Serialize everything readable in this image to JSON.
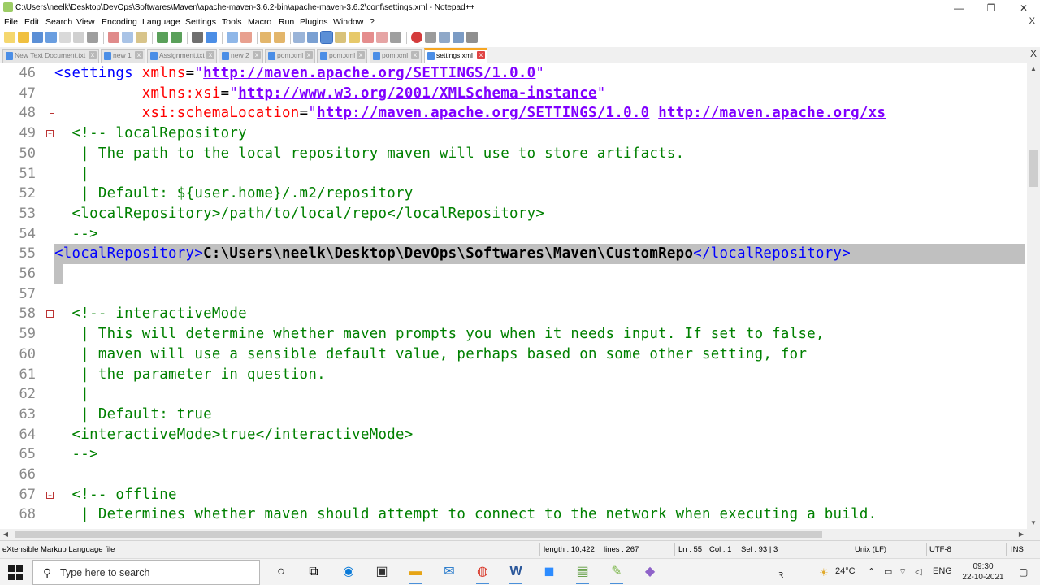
{
  "window": {
    "title": "C:\\Users\\neelk\\Desktop\\DevOps\\Softwares\\Maven\\apache-maven-3.6.2-bin\\apache-maven-3.6.2\\conf\\settings.xml - Notepad++",
    "minimize": "—",
    "maximize": "❐",
    "close": "✕"
  },
  "menu": {
    "items": [
      "File",
      "Edit",
      "Search",
      "View",
      "Encoding",
      "Language",
      "Settings",
      "Tools",
      "Macro",
      "Run",
      "Plugins",
      "Window",
      "?"
    ],
    "close": "X"
  },
  "tabs": [
    {
      "label": "New Text Document.txt",
      "active": false
    },
    {
      "label": "new 1",
      "active": false
    },
    {
      "label": "Assignment.txt",
      "active": false
    },
    {
      "label": "new 2",
      "active": false
    },
    {
      "label": "pom.xml",
      "active": false
    },
    {
      "label": "pom.xml",
      "active": false
    },
    {
      "label": "pom.xml",
      "active": false
    },
    {
      "label": "settings.xml",
      "active": true
    }
  ],
  "tabbar_close": "X",
  "editor": {
    "lines": [
      {
        "n": "46",
        "fold": false,
        "parts": [
          [
            "c-tag",
            "<settings "
          ],
          [
            "c-attr",
            "xmlns"
          ],
          [
            "c-pl",
            "="
          ],
          [
            "c-str",
            "\""
          ],
          [
            "c-val",
            "http://maven.apache.org/SETTINGS/1.0.0"
          ],
          [
            "c-str",
            "\""
          ]
        ]
      },
      {
        "n": "47",
        "fold": false,
        "parts": [
          [
            "c-pl",
            "          "
          ],
          [
            "c-attr",
            "xmlns:xsi"
          ],
          [
            "c-pl",
            "="
          ],
          [
            "c-str",
            "\""
          ],
          [
            "c-val",
            "http://www.w3.org/2001/XMLSchema-instance"
          ],
          [
            "c-str",
            "\""
          ]
        ]
      },
      {
        "n": "48",
        "fold": "end",
        "parts": [
          [
            "c-pl",
            "          "
          ],
          [
            "c-attr",
            "xsi:schemaLocation"
          ],
          [
            "c-pl",
            "="
          ],
          [
            "c-str",
            "\""
          ],
          [
            "c-val",
            "http://maven.apache.org/SETTINGS/1.0.0"
          ],
          [
            "c-pl",
            " "
          ],
          [
            "c-val",
            "http://maven.apache.org/xs"
          ]
        ]
      },
      {
        "n": "49",
        "fold": "start",
        "parts": [
          [
            "c-com",
            "  <!-- localRepository"
          ]
        ]
      },
      {
        "n": "50",
        "fold": false,
        "parts": [
          [
            "c-com",
            "   | The path to the local repository maven will use to store artifacts."
          ]
        ]
      },
      {
        "n": "51",
        "fold": false,
        "parts": [
          [
            "c-com",
            "   |"
          ]
        ]
      },
      {
        "n": "52",
        "fold": false,
        "parts": [
          [
            "c-com",
            "   | Default: ${user.home}/.m2/repository"
          ]
        ]
      },
      {
        "n": "53",
        "fold": false,
        "parts": [
          [
            "c-com",
            "  <localRepository>/path/to/local/repo</localRepository>"
          ]
        ]
      },
      {
        "n": "54",
        "fold": false,
        "parts": [
          [
            "c-com",
            "  -->"
          ]
        ]
      },
      {
        "n": "55",
        "fold": false,
        "selected": true,
        "parts": [
          [
            "c-tag",
            "<localRepository>"
          ],
          [
            "c-txt",
            "C:\\Users\\neelk\\Desktop\\DevOps\\Softwares\\Maven\\CustomRepo"
          ],
          [
            "c-tag",
            "</localRepository>"
          ]
        ]
      },
      {
        "n": "56",
        "fold": false,
        "selected": "caret",
        "parts": []
      },
      {
        "n": "57",
        "fold": false,
        "parts": []
      },
      {
        "n": "58",
        "fold": "start",
        "parts": [
          [
            "c-com",
            "  <!-- interactiveMode"
          ]
        ]
      },
      {
        "n": "59",
        "fold": false,
        "parts": [
          [
            "c-com",
            "   | This will determine whether maven prompts you when it needs input. If set to false,"
          ]
        ]
      },
      {
        "n": "60",
        "fold": false,
        "parts": [
          [
            "c-com",
            "   | maven will use a sensible default value, perhaps based on some other setting, for"
          ]
        ]
      },
      {
        "n": "61",
        "fold": false,
        "parts": [
          [
            "c-com",
            "   | the parameter in question."
          ]
        ]
      },
      {
        "n": "62",
        "fold": false,
        "parts": [
          [
            "c-com",
            "   |"
          ]
        ]
      },
      {
        "n": "63",
        "fold": false,
        "parts": [
          [
            "c-com",
            "   | Default: true"
          ]
        ]
      },
      {
        "n": "64",
        "fold": false,
        "parts": [
          [
            "c-com",
            "  <interactiveMode>true</interactiveMode>"
          ]
        ]
      },
      {
        "n": "65",
        "fold": false,
        "parts": [
          [
            "c-com",
            "  -->"
          ]
        ]
      },
      {
        "n": "66",
        "fold": false,
        "parts": []
      },
      {
        "n": "67",
        "fold": "start",
        "parts": [
          [
            "c-com",
            "  <!-- offline"
          ]
        ]
      },
      {
        "n": "68",
        "fold": false,
        "parts": [
          [
            "c-com",
            "   | Determines whether maven should attempt to connect to the network when executing a build."
          ]
        ]
      }
    ]
  },
  "status": {
    "filetype": "eXtensible Markup Language file",
    "length": "length : 10,422",
    "lines": "lines : 267",
    "ln": "Ln : 55",
    "col": "Col : 1",
    "sel": "Sel : 93 | 3",
    "eol": "Unix (LF)",
    "encoding": "UTF-8",
    "mode": "INS"
  },
  "taskbar": {
    "search_placeholder": "Type here to search",
    "weather": "24°C",
    "language": "ENG",
    "time": "09:30",
    "date": "22-10-2021"
  },
  "colors": {
    "tag": "#0000ff",
    "attr": "#ff0000",
    "value": "#8000ff",
    "comment": "#008000",
    "selection": "#c0c0c0",
    "active_tab_accent": "#f6a623"
  }
}
